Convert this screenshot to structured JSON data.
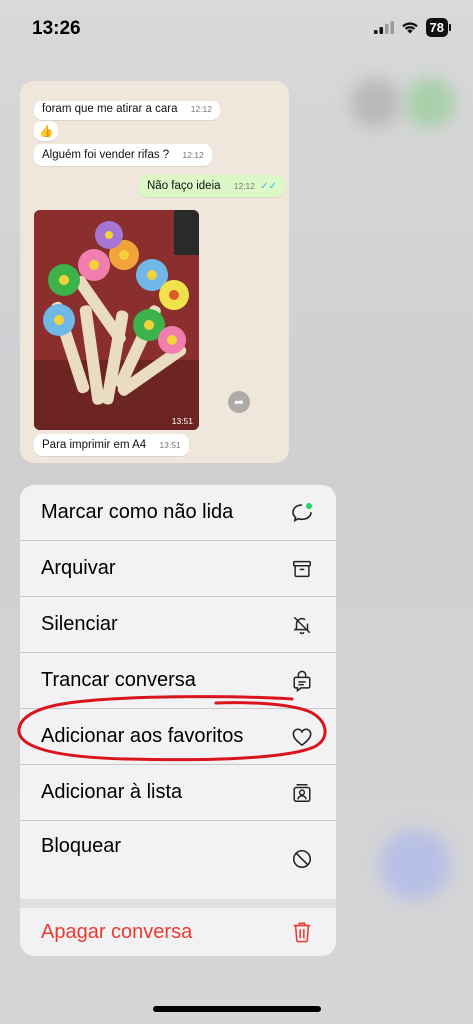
{
  "status_bar": {
    "time": "13:26",
    "battery": "78"
  },
  "preview": {
    "messages": [
      {
        "text": "foram que me atirar a cara",
        "time": "12:12"
      },
      {
        "text": "👍",
        "time": ""
      },
      {
        "text": "Alguém foi vender rifas ?",
        "time": "12:12"
      },
      {
        "text": "Não faço ideia",
        "time": "12:12",
        "read": "✓✓"
      },
      {
        "text": "",
        "time": "13:51"
      },
      {
        "text": "Para imprimir em A4",
        "time": "13:51"
      }
    ]
  },
  "menu": {
    "items": [
      {
        "label": "Marcar como não lida",
        "icon": "unread-chat-icon"
      },
      {
        "label": "Arquivar",
        "icon": "archive-icon"
      },
      {
        "label": "Silenciar",
        "icon": "mute-bell-icon"
      },
      {
        "label": "Trancar conversa",
        "icon": "lock-chat-icon"
      },
      {
        "label": "Adicionar aos favoritos",
        "icon": "heart-icon"
      },
      {
        "label": "Adicionar à lista",
        "icon": "list-contact-icon"
      },
      {
        "label": "Bloquear",
        "icon": "block-icon"
      },
      {
        "label": "Apagar conversa",
        "icon": "trash-icon"
      }
    ]
  },
  "colors": {
    "danger": "#eb3b30",
    "unread_dot": "#25d366",
    "annotation": "#d9141d"
  }
}
